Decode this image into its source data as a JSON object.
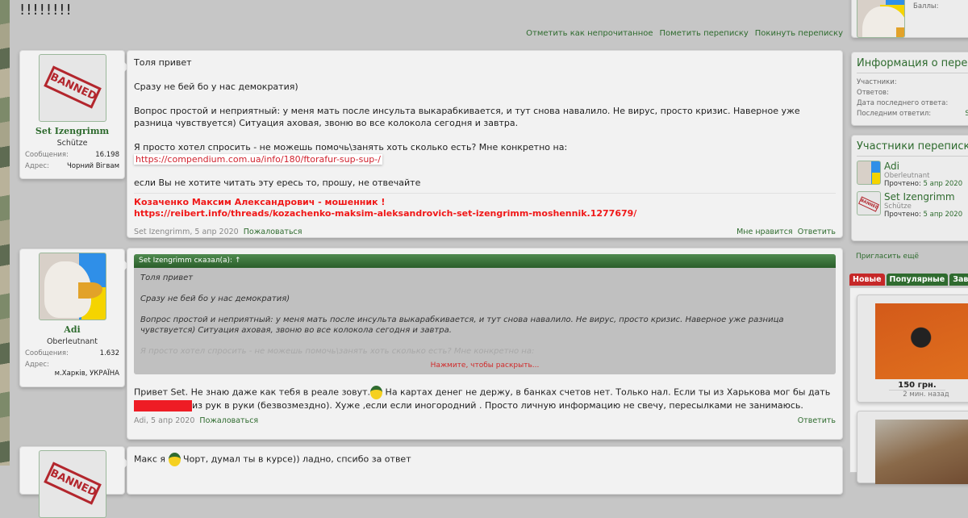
{
  "page": {
    "title": "!!!!!!!!"
  },
  "thread_links": [
    "Отметить как непрочитанное",
    "Пометить переписку",
    "Покинуть переписку"
  ],
  "posts": [
    {
      "user": {
        "name": "Set Izengrimm",
        "rank": "Schütze",
        "messages_label": "Сообщения:",
        "messages": "16.198",
        "address_label": "Адрес:",
        "address": "Чорний Вігвам",
        "avatar_stamp": "BANNED"
      },
      "paragraphs": [
        "Толя привет",
        "Сразу не бей бо у нас демократия)",
        "Вопрос простой и неприятный: у меня мать после инсульта выкарабкивается, и тут снова навалило. Не вирус, просто кризис. Наверное уже разница чувствуется) Ситуация аховая, звоню во все колокола сегодня и завтра.",
        "Я просто хотел спросить - не можешь помочь\\занять хоть сколько есть? Мне конкретно на:",
        "если Вы не хотите читать эту ересь то, прошу, не отвечайте"
      ],
      "link": "https://compendium.com.ua/info/180/ftorafur-sup-sup-/",
      "signature": [
        "Козаченко Максим Александрович - мошенник !",
        "https://reibert.info/threads/kozachenko-maksim-aleksandrovich-set-izengrimm-moshennik.1277679/"
      ],
      "meta": "Set Izengrimm, 5 апр 2020",
      "report": "Пожаловаться",
      "like": "Мне нравится",
      "reply": "Ответить"
    },
    {
      "user": {
        "name": "Adi",
        "rank": "Oberleutnant",
        "messages_label": "Сообщения:",
        "messages": "1.632",
        "address_label": "Адрес:",
        "address": "м.Харків, УКРАЇНА"
      },
      "quote": {
        "header": "Set Izengrimm сказал(а): ↑",
        "paragraphs": [
          "Толя привет",
          "Сразу не бей бо у нас демократия)",
          "Вопрос простой и неприятный: у меня мать после инсульта выкарабкивается, и тут снова навалило. Не вирус, просто кризис. Наверное уже разница чувствуется) Ситуация аховая, звоню во все колокола сегодня и завтра."
        ],
        "faded": "Я просто хотел спросить - не можешь помочь\\занять хоть сколько есть? Мне конкретно на:",
        "expand": "Нажмите, чтобы раскрыть..."
      },
      "text_a": "Привет Set. Не знаю даже как тебя в реале зовут.",
      "text_b": " На картах денег не держу, в банках счетов нет. Только нал. Если ты из Харькова мог бы дать",
      "text_c": "из рук в руки (безвозмездно). Хуже ,если если иногородний . Просто личную информацию не свечу, пересылками не занимаюсь.",
      "meta": "Adi, 5 апр 2020",
      "report": "Пожаловаться",
      "reply": "Ответить"
    },
    {
      "text_a": "Макс я",
      "text_b": " Чорт, думал ты в курсе)) ладно, спсибо за ответ"
    }
  ],
  "sidebar": {
    "profile_points_label": "Баллы:",
    "info": {
      "title": "Информация о переписке",
      "rows": [
        "Участники:",
        "Ответов:",
        "Дата последнего ответа:",
        "Последним ответил:"
      ],
      "last_replier": "Se"
    },
    "participants": {
      "title": "Участники переписки",
      "items": [
        {
          "name": "Adi",
          "rank": "Oberleutnant",
          "read_label": "Прочтено:",
          "read": "5 апр 2020"
        },
        {
          "name": "Set Izengrimm",
          "rank": "Schütze",
          "read_label": "Прочтено:",
          "read": "5 апр 2020"
        }
      ]
    },
    "invite": "Пригласить ещё",
    "tabs": [
      "Новые",
      "Популярные",
      "Заверш"
    ],
    "listing": {
      "price": "150 грн.",
      "ago": "2 мин. назад"
    }
  },
  "colors": {
    "accent": "#2e6b2e",
    "warning": "#f01818",
    "tab_active": "#c62828"
  }
}
